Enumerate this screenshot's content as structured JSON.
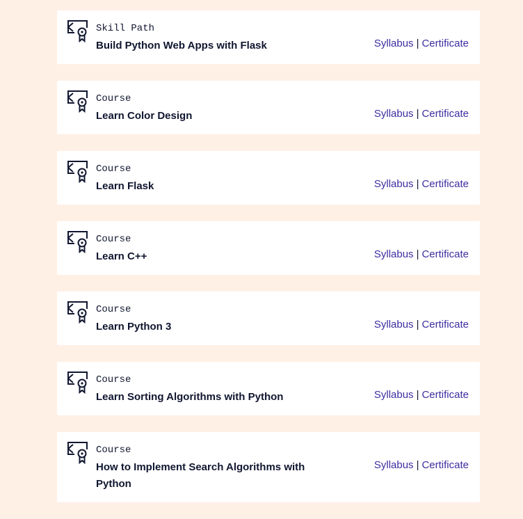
{
  "colors": {
    "page_background": "#fff0e5",
    "card_background": "#ffffff",
    "text": "#10162f",
    "link": "#3c2da0"
  },
  "items": [
    {
      "type": "Skill Path",
      "title": "Build Python Web Apps with Flask",
      "syllabus_label": "Syllabus",
      "separator": "|",
      "certificate_label": "Certificate",
      "icon": "certificate-icon"
    },
    {
      "type": "Course",
      "title": "Learn Color Design",
      "syllabus_label": "Syllabus",
      "separator": "|",
      "certificate_label": "Certificate",
      "icon": "certificate-icon"
    },
    {
      "type": "Course",
      "title": "Learn Flask",
      "syllabus_label": "Syllabus",
      "separator": "|",
      "certificate_label": "Certificate",
      "icon": "certificate-icon"
    },
    {
      "type": "Course",
      "title": "Learn C++",
      "syllabus_label": "Syllabus",
      "separator": "|",
      "certificate_label": "Certificate",
      "icon": "certificate-icon"
    },
    {
      "type": "Course",
      "title": "Learn Python 3",
      "syllabus_label": "Syllabus",
      "separator": "|",
      "certificate_label": "Certificate",
      "icon": "certificate-icon"
    },
    {
      "type": "Course",
      "title": "Learn Sorting Algorithms with Python",
      "syllabus_label": "Syllabus",
      "separator": "|",
      "certificate_label": "Certificate",
      "icon": "certificate-icon"
    },
    {
      "type": "Course",
      "title": "How to Implement Search Algorithms with Python",
      "syllabus_label": "Syllabus",
      "separator": "|",
      "certificate_label": "Certificate",
      "icon": "certificate-icon"
    }
  ]
}
